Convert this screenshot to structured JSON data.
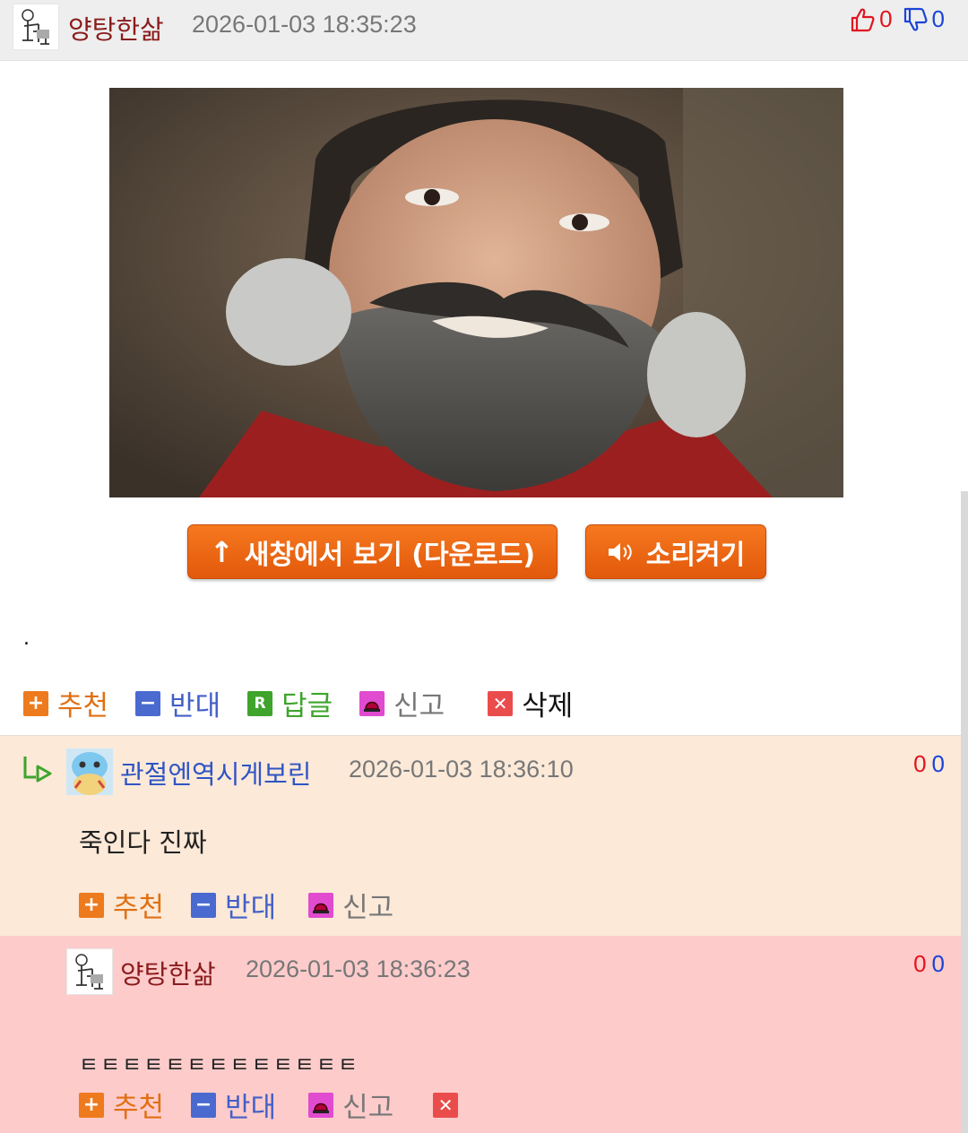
{
  "post": {
    "author": "양탕한삶",
    "timestamp": "2026-01-03 18:35:23",
    "upvotes": "0",
    "downvotes": "0",
    "body_text": "."
  },
  "buttons": {
    "new_window": "새창에서 보기 (다운로드)",
    "sound_on": "소리켜기"
  },
  "post_actions": {
    "recommend": "추천",
    "oppose": "반대",
    "reply": "답글",
    "report": "신고",
    "delete": "삭제"
  },
  "comments": [
    {
      "author": "관절엔역시게보린",
      "timestamp": "2026-01-03 18:36:10",
      "upvotes": "0",
      "downvotes": "0",
      "text": "죽인다 진짜",
      "actions": {
        "recommend": "추천",
        "oppose": "반대",
        "report": "신고"
      }
    },
    {
      "author": "양탕한삶",
      "timestamp": "2026-01-03 18:36:23",
      "upvotes": "0",
      "downvotes": "0",
      "text": "ㅌㅌㅌㅌㅌㅌㅌㅌㅌㅌㅌㅌㅌ",
      "actions": {
        "recommend": "추천",
        "oppose": "반대",
        "report": "신고"
      }
    }
  ],
  "icons": {
    "thumb_up": "thumbs-up-icon",
    "thumb_down": "thumbs-down-icon",
    "plus": "plus-icon",
    "minus": "minus-icon",
    "reply": "reply-r-icon",
    "report": "siren-icon",
    "delete": "x-icon"
  },
  "colors": {
    "accent_orange": "#e8600f",
    "author_red": "#8a1c1c",
    "author_blue": "#2f55c5",
    "comment1_bg": "#fce9d8",
    "comment2_bg": "#fecbcb"
  }
}
